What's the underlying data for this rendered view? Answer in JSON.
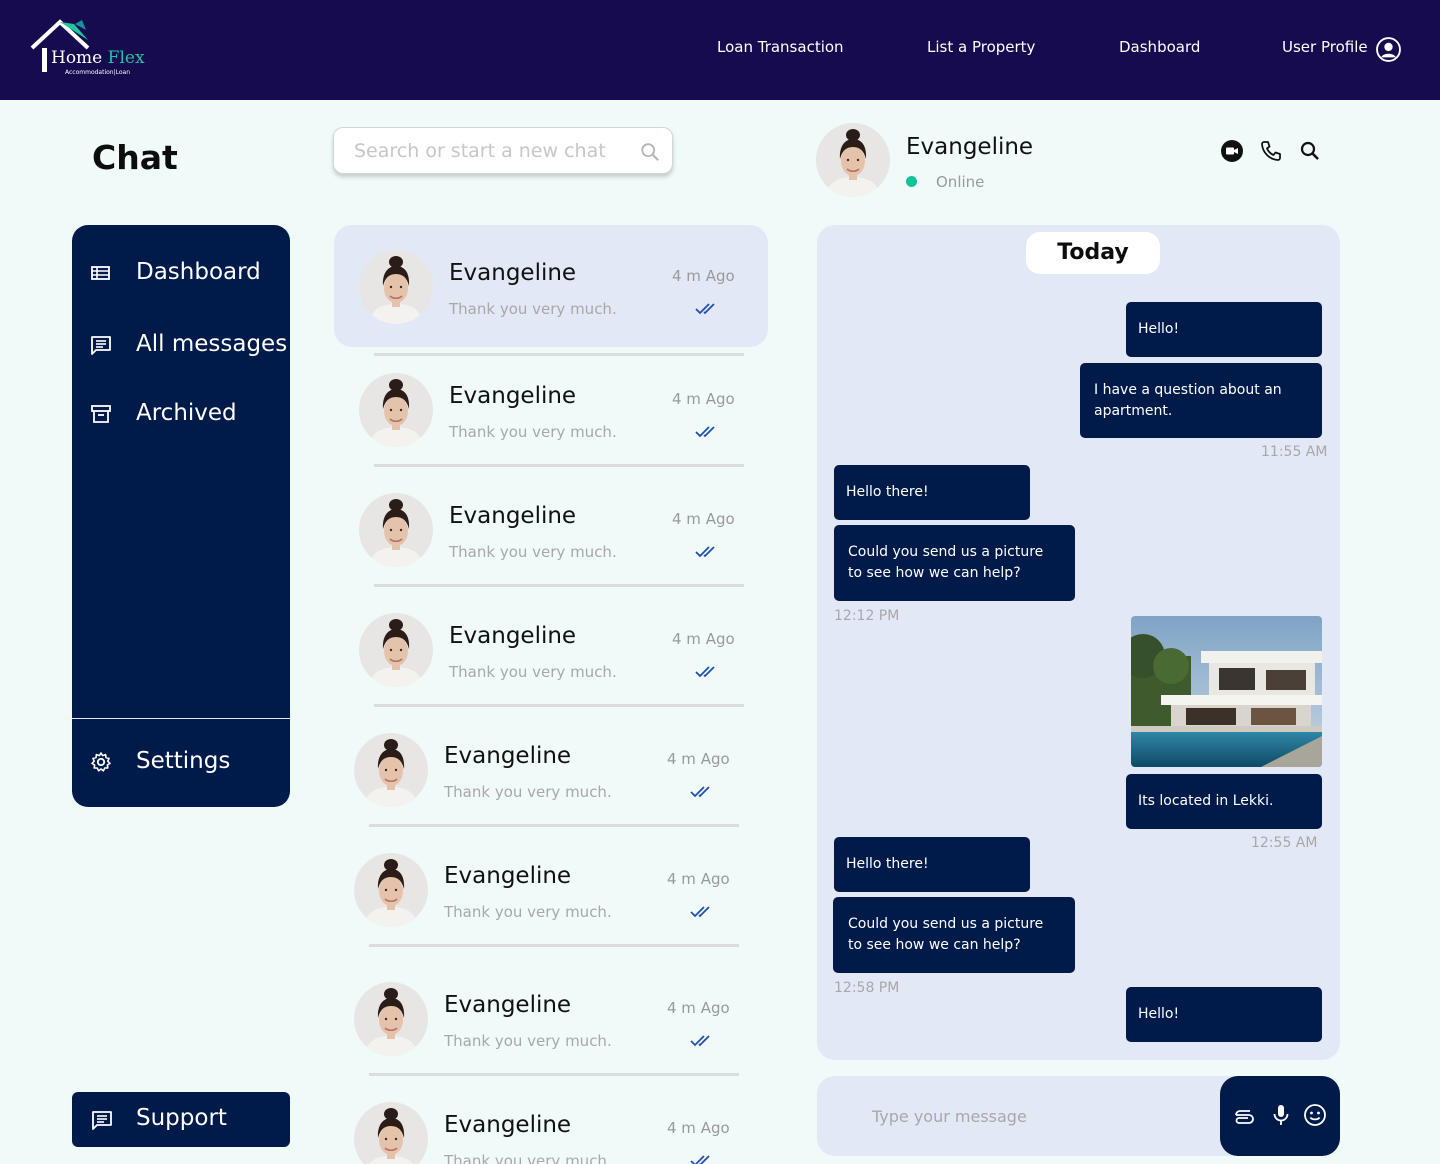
{
  "brand": {
    "name_part1": "Home",
    "name_part2": "Flex",
    "tagline": "Accommodation|Loan"
  },
  "nav": {
    "items": [
      {
        "label": "Loan Transaction"
      },
      {
        "label": "List a Property"
      },
      {
        "label": "Dashboard"
      },
      {
        "label": "User Profile"
      }
    ]
  },
  "page": {
    "title": "Chat"
  },
  "search": {
    "placeholder": "Search or start a new chat"
  },
  "sidebar": {
    "items": [
      {
        "label": "Dashboard",
        "icon": "list-icon"
      },
      {
        "label": "All messages",
        "icon": "message-icon"
      },
      {
        "label": "Archived",
        "icon": "archive-icon"
      }
    ],
    "settings": {
      "label": "Settings",
      "icon": "gear-icon"
    },
    "support": {
      "label": "Support",
      "icon": "support-icon"
    }
  },
  "conversations": [
    {
      "name": "Evangeline",
      "time": "4 m Ago",
      "preview": "Thank you very much.",
      "active": true
    },
    {
      "name": "Evangeline",
      "time": "4 m Ago",
      "preview": "Thank you very much."
    },
    {
      "name": "Evangeline",
      "time": "4 m Ago",
      "preview": "Thank you very much."
    },
    {
      "name": "Evangeline",
      "time": "4 m Ago",
      "preview": "Thank you very much."
    },
    {
      "name": "Evangeline",
      "time": "4 m Ago",
      "preview": "Thank you very much."
    },
    {
      "name": "Evangeline",
      "time": "4 m Ago",
      "preview": "Thank you very much."
    },
    {
      "name": "Evangeline",
      "time": "4 m Ago",
      "preview": "Thank you very much."
    },
    {
      "name": "Evangeline",
      "time": "4 m Ago",
      "preview": "Thank you very much."
    }
  ],
  "chat": {
    "contact_name": "Evangeline",
    "status": "Online",
    "day_label": "Today",
    "messages": [
      {
        "text": "Hello!",
        "from": "me"
      },
      {
        "text": "I have a question about an apartment.",
        "from": "me"
      },
      {
        "stamp": "11:55 AM"
      },
      {
        "text": "Hello there!",
        "from": "them"
      },
      {
        "text": "Could you send us a picture to see how we can help?",
        "from": "them"
      },
      {
        "stamp": "12:12 PM"
      },
      {
        "image": "house-photo",
        "from": "me"
      },
      {
        "text": "Its located in Lekki.",
        "from": "me"
      },
      {
        "stamp": "12:55 AM"
      },
      {
        "text": "Hello there!",
        "from": "them"
      },
      {
        "text": "Could you send us a picture to see how we can help?",
        "from": "them"
      },
      {
        "stamp": "12:58 PM"
      },
      {
        "text": "Hello!",
        "from": "me"
      }
    ]
  },
  "composer": {
    "placeholder": "Type your message",
    "actions": [
      "paperclip-icon",
      "microphone-icon",
      "emoji-icon"
    ]
  },
  "colors": {
    "topbar": "#170b4f",
    "navy": "#001a4a",
    "panel": "#e3e8f6",
    "background": "#f0faf8",
    "online": "#12c29a",
    "ticks": "#1f4fb5"
  }
}
